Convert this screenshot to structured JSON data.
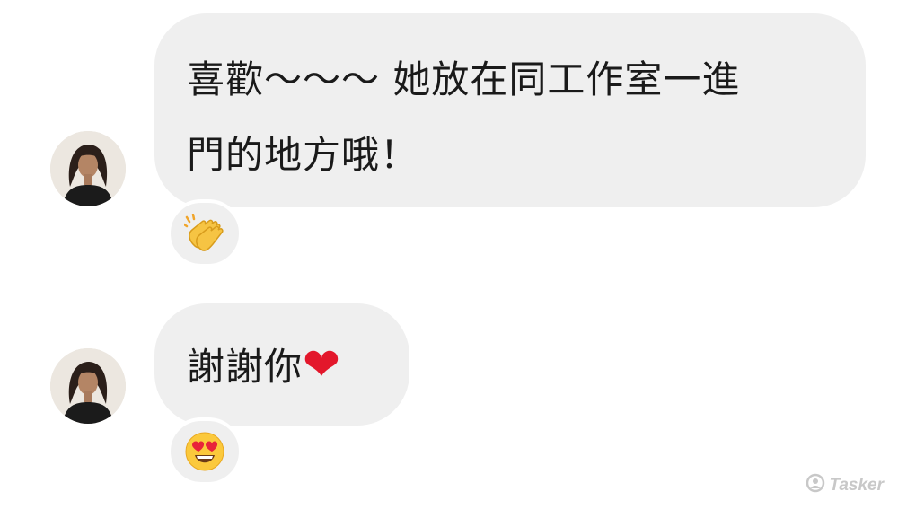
{
  "messages": [
    {
      "lines": [
        "喜歡～～～ 她放在同工作室一進",
        "門的地方哦！"
      ],
      "reaction": "clapping-hands-emoji"
    },
    {
      "text": "謝謝你",
      "text_emoji": "❤",
      "reaction": "heart-eyes-emoji"
    }
  ],
  "watermark": {
    "text": "Tasker"
  },
  "colors": {
    "bubble": "#efefef",
    "text": "#1a1a1a",
    "heart": "#e3172b",
    "watermark": "#c8c8c8"
  }
}
